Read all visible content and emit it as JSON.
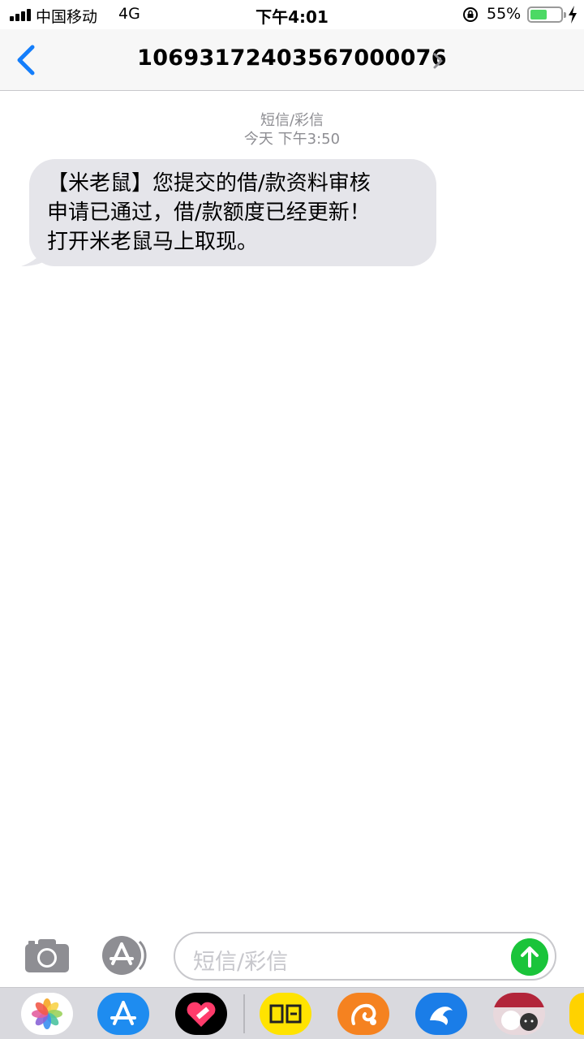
{
  "status_bar": {
    "carrier": "中国移动",
    "network": "4G",
    "time": "下午4:01",
    "battery_percent_label": "55%",
    "battery_level": 0.55
  },
  "header": {
    "sender": "10693172403567000076"
  },
  "conversation": {
    "service_label": "短信/彩信",
    "timestamp": "今天 下午3:50",
    "messages": [
      {
        "direction": "incoming",
        "lines": [
          "【米老鼠】您提交的借/款资料审核",
          "申请已通过，借/款额度已经更新！",
          "打开米老鼠马上取现。"
        ]
      }
    ]
  },
  "composer": {
    "placeholder": "短信/彩信"
  },
  "app_drawer": {
    "apps": [
      "photos-icon",
      "app-store-icon",
      "heart-app-icon",
      "xianyu-icon",
      "uc-browser-icon",
      "dolphin-app-icon",
      "cat-stickers-icon"
    ]
  },
  "colors": {
    "accent": "#147efb",
    "bubble_incoming": "#e5e5ea",
    "send_button": "#1ac43a",
    "battery": "#4cd964"
  }
}
